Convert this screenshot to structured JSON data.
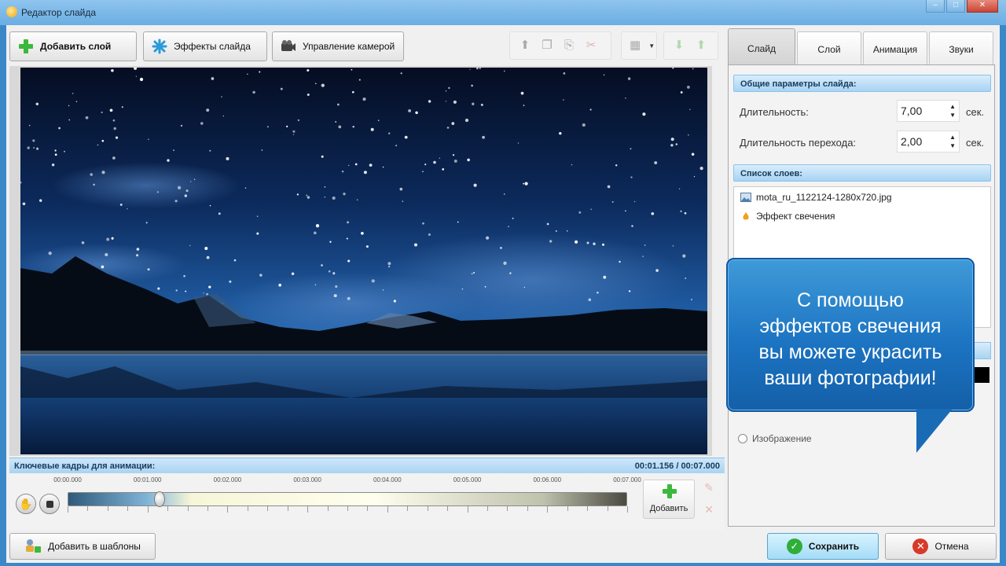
{
  "window": {
    "title": "Редактор слайда"
  },
  "toolbar": {
    "add_layer": "Добавить слой",
    "slide_effects": "Эффекты слайда",
    "camera_control": "Управление камерой"
  },
  "keyframes": {
    "header": "Ключевые кадры для анимации:",
    "time_readout": "00:01.156 / 00:07.000",
    "ruler_labels": [
      "00:00.000",
      "00:01.000",
      "00:02.000",
      "00:03.000",
      "00:04.000",
      "00:05.000",
      "00:06.000",
      "00:07.000"
    ],
    "playhead_fraction": 0.165,
    "add_label": "Добавить"
  },
  "tabs": [
    "Слайд",
    "Слой",
    "Анимация",
    "Звуки"
  ],
  "active_tab": "Слайд",
  "slide_params": {
    "header": "Общие параметры слайда:",
    "duration_label": "Длительность:",
    "duration_value": "7,00",
    "transition_label": "Длительность перехода:",
    "transition_value": "2,00",
    "unit": "сек."
  },
  "layers": {
    "header": "Список слоев:",
    "items": [
      {
        "name": "mota_ru_1122124-1280x720.jpg",
        "icon": "image-icon"
      },
      {
        "name": "Эффект свечения",
        "icon": "glow-effect-icon"
      }
    ]
  },
  "partial_option": "Изображение",
  "callout": {
    "lines": [
      "С помощью",
      "эффектов свечения",
      "вы можете украсить",
      "ваши фотографии!"
    ]
  },
  "footer": {
    "add_template": "Добавить в шаблоны",
    "save": "Сохранить",
    "cancel": "Отмена"
  },
  "colors": {
    "accent": "#1c74c2",
    "title_bar": "#6aaee2",
    "save_button": "#a4dcf7"
  }
}
